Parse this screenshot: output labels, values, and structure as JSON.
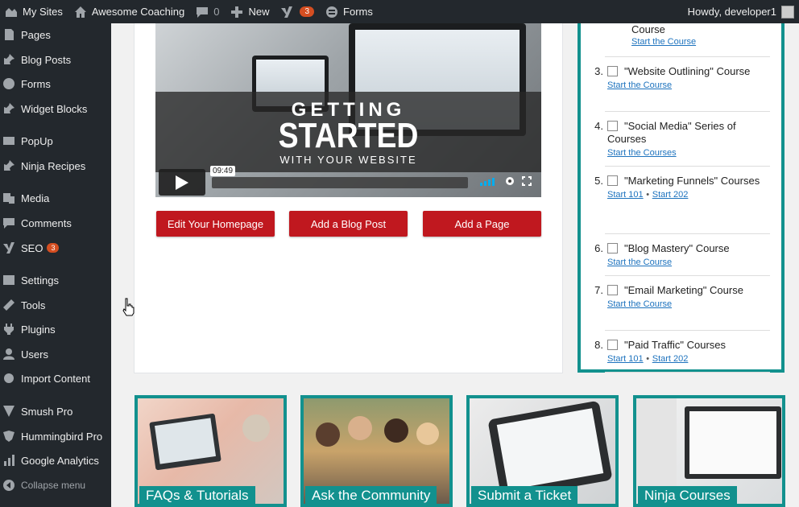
{
  "adminbar": {
    "my_sites": "My Sites",
    "site_name": "Awesome Coaching",
    "comments_count": "0",
    "new_label": "New",
    "seo_count": "3",
    "forms_label": "Forms",
    "howdy": "Howdy, developer1"
  },
  "sidebar": {
    "items": [
      {
        "label": "Pages",
        "icon": "pages-icon"
      },
      {
        "label": "Blog Posts",
        "icon": "pin-icon"
      },
      {
        "label": "Forms",
        "icon": "forms-icon"
      },
      {
        "label": "Widget Blocks",
        "icon": "pin-icon"
      },
      {
        "label": "PopUp",
        "icon": "popup-icon"
      },
      {
        "label": "Ninja Recipes",
        "icon": "pin-icon"
      },
      {
        "label": "Media",
        "icon": "media-icon"
      },
      {
        "label": "Comments",
        "icon": "comments-icon"
      },
      {
        "label": "SEO",
        "icon": "yoast-icon",
        "badge": "3"
      },
      {
        "label": "Settings",
        "icon": "settings-icon"
      },
      {
        "label": "Tools",
        "icon": "tools-icon"
      },
      {
        "label": "Plugins",
        "icon": "plugins-icon"
      },
      {
        "label": "Users",
        "icon": "users-icon"
      },
      {
        "label": "Import Content",
        "icon": "gear-icon"
      },
      {
        "label": "Smush Pro",
        "icon": "smush-icon"
      },
      {
        "label": "Hummingbird Pro",
        "icon": "hummingbird-icon"
      },
      {
        "label": "Google Analytics",
        "icon": "analytics-icon"
      }
    ],
    "collapse_label": "Collapse menu"
  },
  "video": {
    "title_line1": "GETTING",
    "title_line2": "STARTED",
    "title_line3": "WITH YOUR WEBSITE",
    "duration": "09:49"
  },
  "actions": {
    "edit_homepage": "Edit Your Homepage",
    "add_blog_post": "Add a Blog Post",
    "add_page": "Add a Page"
  },
  "checklist": {
    "top_partial_title": "Course",
    "top_partial_link": "Start the Course",
    "items": [
      {
        "num": "3.",
        "title": "\"Website Outlining\" Course",
        "links": [
          "Start the Course"
        ]
      },
      {
        "num": "4.",
        "title": "\"Social Media\" Series of Courses",
        "links": [
          "Start the Courses"
        ]
      },
      {
        "num": "5.",
        "title": "\"Marketing Funnels\" Courses",
        "links": [
          "Start 101",
          "Start 202"
        ]
      },
      {
        "num": "6.",
        "title": "\"Blog Mastery\" Course",
        "links": [
          "Start the Course"
        ]
      },
      {
        "num": "7.",
        "title": "\"Email Marketing\" Course",
        "links": [
          "Start the Course"
        ]
      },
      {
        "num": "8.",
        "title": "\"Paid Traffic\" Courses",
        "links": [
          "Start 101",
          "Start 202"
        ]
      }
    ],
    "separator": "•"
  },
  "tiles": [
    {
      "label": "FAQs & Tutorials"
    },
    {
      "label": "Ask the Community"
    },
    {
      "label": "Submit a Ticket"
    },
    {
      "label": "Ninja Courses"
    }
  ],
  "colors": {
    "admin_dark": "#23282d",
    "accent_teal": "#12918e",
    "cta_red": "#c0181f",
    "badge_orange": "#d54e21",
    "link_blue": "#1e73be"
  }
}
